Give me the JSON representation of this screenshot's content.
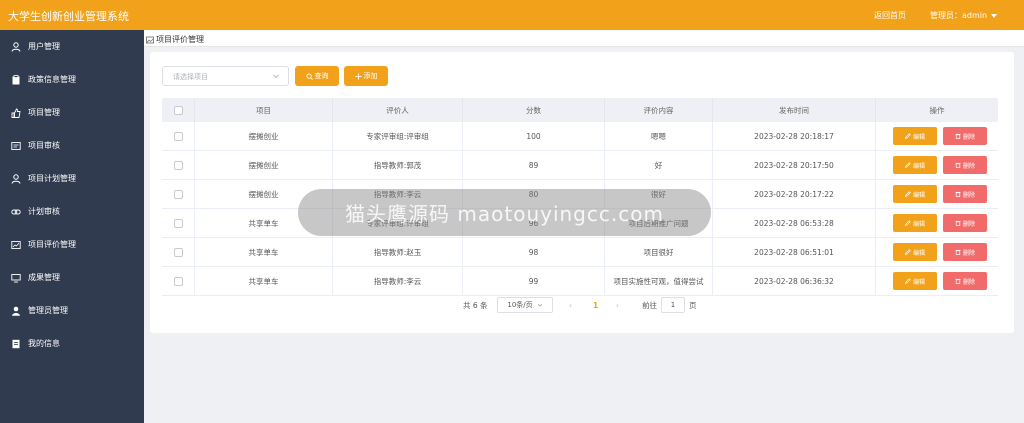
{
  "app": {
    "title": "大学生创新创业管理系统",
    "home_link": "返回首页",
    "admin_label": "管理员：admin"
  },
  "sidebar": {
    "items": [
      {
        "label": "用户管理",
        "icon": "user-icon"
      },
      {
        "label": "政策信息管理",
        "icon": "clipboard-icon"
      },
      {
        "label": "项目管理",
        "icon": "thumbs-up-icon"
      },
      {
        "label": "项目审核",
        "icon": "review-icon"
      },
      {
        "label": "项目计划管理",
        "icon": "user-icon"
      },
      {
        "label": "计划审核",
        "icon": "link-icon"
      },
      {
        "label": "项目评价管理",
        "icon": "chart-icon"
      },
      {
        "label": "成果管理",
        "icon": "monitor-icon"
      },
      {
        "label": "管理员管理",
        "icon": "person-filled-icon"
      },
      {
        "label": "我的信息",
        "icon": "document-icon"
      }
    ]
  },
  "breadcrumb": {
    "label": "项目评价管理"
  },
  "filter": {
    "placeholder": "请选择项目",
    "search_label": "查询",
    "add_label": "添加"
  },
  "table": {
    "headers": [
      "项目",
      "评价人",
      "分数",
      "评价内容",
      "发布时间",
      "操作"
    ],
    "edit_label": "编辑",
    "delete_label": "删除",
    "rows": [
      [
        "摆摊创业",
        "专家评审组:评审组",
        "100",
        "嗯嗯",
        "2023-02-28 20:18:17"
      ],
      [
        "摆摊创业",
        "指导教师:郭茂",
        "89",
        "好",
        "2023-02-28 20:17:50"
      ],
      [
        "摆摊创业",
        "指导教师:李云",
        "80",
        "很好",
        "2023-02-28 20:17:22"
      ],
      [
        "共享单车",
        "专家评审组:评审组",
        "96",
        "项目后期推广问题",
        "2023-02-28 06:53:28"
      ],
      [
        "共享单车",
        "指导教师:赵玉",
        "98",
        "项目很好",
        "2023-02-28 06:51:01"
      ],
      [
        "共享单车",
        "指导教师:李云",
        "99",
        "项目实施性可观，值得尝试",
        "2023-02-28 06:36:32"
      ]
    ]
  },
  "pagination": {
    "total": "共 6 条",
    "page_size": "10条/页",
    "current_page": "1",
    "goto_label": "前往",
    "goto_value": "1",
    "page_suffix": "页"
  },
  "overlay": {
    "text": "猫头鹰源码 maotouyingcc.com"
  },
  "colors": {
    "accent": "#f2a21a",
    "sidebar": "#313b4f",
    "danger": "#f16b6b"
  }
}
